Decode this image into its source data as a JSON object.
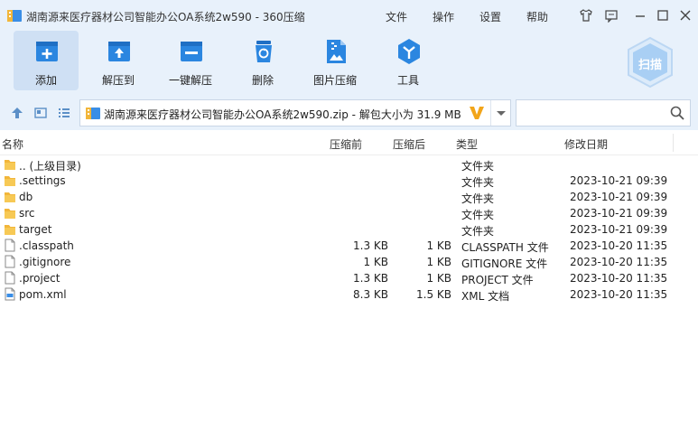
{
  "window": {
    "title": "湖南源来医疗器材公司智能办公OA系统2w590 - 360压缩",
    "menu": [
      "文件",
      "操作",
      "设置",
      "帮助"
    ]
  },
  "toolbar": {
    "buttons": [
      {
        "label": "添加",
        "icon": "add-icon"
      },
      {
        "label": "解压到",
        "icon": "extract-to-icon"
      },
      {
        "label": "一键解压",
        "icon": "one-click-extract-icon"
      },
      {
        "label": "删除",
        "icon": "recycle-bin-icon"
      },
      {
        "label": "图片压缩",
        "icon": "image-compress-icon"
      },
      {
        "label": "工具",
        "icon": "tools-icon"
      }
    ],
    "scan_label": "扫描"
  },
  "address": {
    "path": "湖南源来医疗器材公司智能办公OA系统2w590.zip - 解包大小为 31.9 MB",
    "search_value": ""
  },
  "columns": {
    "name": "名称",
    "size": "压缩前",
    "packed": "压缩后",
    "type": "类型",
    "modified": "修改日期"
  },
  "files": [
    {
      "name": ".. (上级目录)",
      "size": "",
      "packed": "",
      "type": "文件夹",
      "modified": "",
      "icon": "folder-icon"
    },
    {
      "name": ".settings",
      "size": "",
      "packed": "",
      "type": "文件夹",
      "modified": "2023-10-21 09:39",
      "icon": "folder-icon"
    },
    {
      "name": "db",
      "size": "",
      "packed": "",
      "type": "文件夹",
      "modified": "2023-10-21 09:39",
      "icon": "folder-icon"
    },
    {
      "name": "src",
      "size": "",
      "packed": "",
      "type": "文件夹",
      "modified": "2023-10-21 09:39",
      "icon": "folder-icon"
    },
    {
      "name": "target",
      "size": "",
      "packed": "",
      "type": "文件夹",
      "modified": "2023-10-21 09:39",
      "icon": "folder-icon"
    },
    {
      "name": ".classpath",
      "size": "1.3 KB",
      "packed": "1 KB",
      "type": "CLASSPATH 文件",
      "modified": "2023-10-20 11:35",
      "icon": "file-icon"
    },
    {
      "name": ".gitignore",
      "size": "1 KB",
      "packed": "1 KB",
      "type": "GITIGNORE 文件",
      "modified": "2023-10-20 11:35",
      "icon": "file-icon"
    },
    {
      "name": ".project",
      "size": "1.3 KB",
      "packed": "1 KB",
      "type": "PROJECT 文件",
      "modified": "2023-10-20 11:35",
      "icon": "file-icon"
    },
    {
      "name": "pom.xml",
      "size": "8.3 KB",
      "packed": "1.5 KB",
      "type": "XML 文档",
      "modified": "2023-10-20 11:35",
      "icon": "xml-file-icon"
    }
  ],
  "colors": {
    "chrome": "#e8f1fb",
    "accent": "#2b86e0",
    "folder": "#f2b63a"
  }
}
